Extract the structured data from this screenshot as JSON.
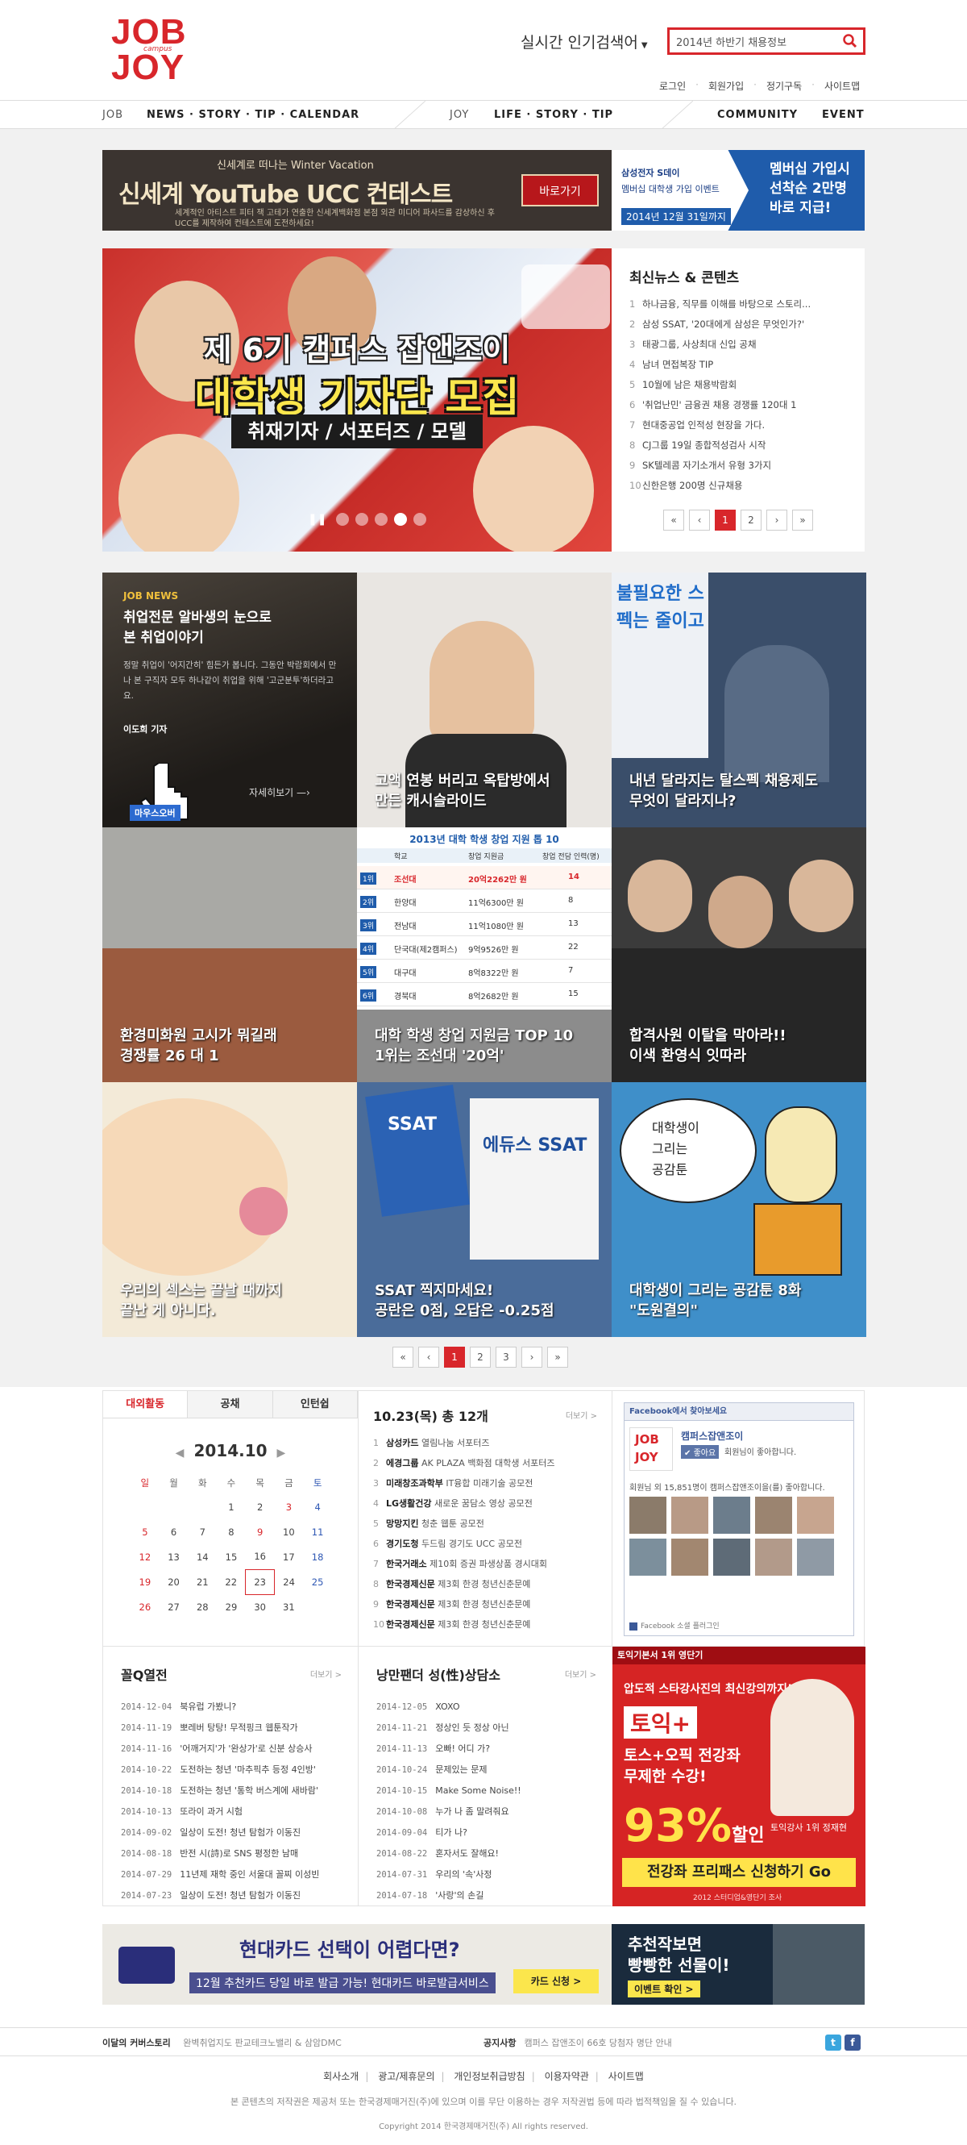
{
  "logo": {
    "line1": "JOB",
    "line2": "JOY",
    "small": "campus"
  },
  "header": {
    "popular_label": "실시간 인기검색어",
    "search_value": "2014년 하반기 채용정보",
    "utils": [
      "로그인",
      "회원가입",
      "정기구독",
      "사이트맵"
    ]
  },
  "gnb": {
    "job_label": "JOB",
    "job_menu": "NEWS · STORY · TIP · CALENDAR",
    "joy_label": "JOY",
    "joy_menu": "LIFE · STORY · TIP",
    "community": "COMMUNITY",
    "event": "EVENT"
  },
  "banner_top": {
    "left": {
      "eyebrow": "신세계로 떠나는 Winter Vacation",
      "title": "신세계 YouTube UCC 컨테스트",
      "desc": "세계적인 아티스트 피터 잭 고테가 연출한 신세계백화점 본점 외관 미디어 파사드를 감상하신 후 UCC를 제작하여 컨테스트에 도전하세요!",
      "button": "바로가기"
    },
    "right": {
      "brand": "삼성전자 S데이",
      "sub": "멤버십 대학생 가입 이벤트",
      "date": "2014년 12월 31일까지",
      "headline": "멤버십 가입시\n선착순 2만명\n바로 지급!"
    }
  },
  "hero": {
    "line1": "제 6기 캠퍼스 잡앤조이",
    "line2": "대학생 기자단 모집",
    "line3": "취재기자 / 서포터즈 / 모델",
    "dots": 5,
    "active_dot": 4
  },
  "latest": {
    "title": "최신뉴스 & 콘텐츠",
    "items": [
      {
        "n": "1",
        "t": "하나금융, 직무를 이해를 바탕으로 스토리..."
      },
      {
        "n": "2",
        "t": "삼성 SSAT, '20대에게 삼성은 무엇인가?'"
      },
      {
        "n": "3",
        "t": "태광그룹, 사상최대 신입 공채"
      },
      {
        "n": "4",
        "t": "남녀 면접복장 TIP"
      },
      {
        "n": "5",
        "t": "10월에 남은 채용박람회"
      },
      {
        "n": "6",
        "t": "'취업난민' 금융권 채용 경쟁률 120대 1"
      },
      {
        "n": "7",
        "t": "현대중공업 인적성 현장을 가다."
      },
      {
        "n": "8",
        "t": "CJ그룹 19일 종합적성검사 시작"
      },
      {
        "n": "9",
        "t": "SK텔레콤 자기소개서 유형 3가지"
      },
      {
        "n": "10",
        "t": "신한은행 200명 신규채용"
      }
    ],
    "pager": [
      "«",
      "‹",
      "1",
      "2",
      "›",
      "»"
    ],
    "current_page": "1"
  },
  "tiles": {
    "t1": {
      "tag": "JOB NEWS",
      "title": "취업전문 알바생의 눈으로\n본 취업이야기",
      "body": "정말 취업이 '어지간히' 힘든가 봅니다. 그동안 박람회에서 만나 본 구직자 모두 하나같이 취업을 위해 '고군분투'하더라고요.",
      "author": "이도희 기자",
      "more": "자세히보기",
      "hover_label": "마우스오버"
    },
    "t2": {
      "cap": "고액 연봉 버리고 옥탑방에서\n만든 캐시슬라이드"
    },
    "t3": {
      "cap": "내년 달라지는 탈스펙 채용제도\n무엇이 달라지나?",
      "sign": "불필요한 스펙는 줄이고"
    },
    "t4": {
      "cap": "환경미화원 고시가 뭐길래\n경쟁률 26 대 1"
    },
    "t5": {
      "cap": "대학 학생 창업 지원금 TOP 10\n1위는 조선대 '20억'",
      "table_title": "2013년 대학 학생 창업 지원 톱 10",
      "cols": [
        "학교",
        "창업 지원금",
        "창업 전담 인력(명)"
      ],
      "rows": [
        [
          "1위",
          "조선대",
          "20억2262만 원",
          "14"
        ],
        [
          "2위",
          "한양대",
          "11억6300만 원",
          "8"
        ],
        [
          "3위",
          "전남대",
          "11억1080만 원",
          "13"
        ],
        [
          "4위",
          "단국대(제2캠퍼스)",
          "9억9526만 원",
          "22"
        ],
        [
          "5위",
          "대구대",
          "8억8322만 원",
          "7"
        ],
        [
          "6위",
          "경북대",
          "8억2682만 원",
          "15"
        ]
      ]
    },
    "t6": {
      "cap": "합격사원 이탈을 막아라!!\n이색 환영식 잇따라"
    },
    "t7": {
      "cap": "우리의 섹스는 끝날 때까지\n끝난 게 아니다."
    },
    "t8": {
      "cap": "SSAT 찍지마세요!\n공란은 0점, 오답은 -0.25점",
      "book1": "SSAT",
      "book2": "에듀스 SSAT"
    },
    "t9": {
      "cap": "대학생이 그리는 공감툰 8화\n\"도원결의\"",
      "bubble": "대학생이\n그리는\n공감툰"
    }
  },
  "grid_pager": [
    "«",
    "‹",
    "1",
    "2",
    "3",
    "›",
    "»"
  ],
  "calendar": {
    "tabs": [
      "대외활동",
      "공채",
      "인턴쉽"
    ],
    "month": "2014.10",
    "weekdays": [
      "일",
      "월",
      "화",
      "수",
      "목",
      "금",
      "토"
    ],
    "weeks": [
      [
        "",
        "",
        "",
        "1",
        "2",
        "3",
        "4"
      ],
      [
        "5",
        "6",
        "7",
        "8",
        "9",
        "10",
        "11"
      ],
      [
        "12",
        "13",
        "14",
        "15",
        "16",
        "17",
        "18"
      ],
      [
        "19",
        "20",
        "21",
        "22",
        "23",
        "24",
        "25"
      ],
      [
        "26",
        "27",
        "28",
        "29",
        "30",
        "31",
        ""
      ]
    ],
    "today": "23"
  },
  "events": {
    "title": "10.23(목) 총 12개",
    "more": "더보기 >",
    "items": [
      {
        "n": "1",
        "org": "삼성카드",
        "t": "열림나눔 서포터즈"
      },
      {
        "n": "2",
        "org": "에경그룹",
        "t": "AK PLAZA 백화점 대학생 서포터즈"
      },
      {
        "n": "3",
        "org": "미래창조과학부",
        "t": "IT융합 미래기술 공모전"
      },
      {
        "n": "4",
        "org": "LG생활건강",
        "t": "새로운 꿈담소 영상 공모전"
      },
      {
        "n": "5",
        "org": "망망지킨",
        "t": "청춘 웹툰 공모전"
      },
      {
        "n": "6",
        "org": "경기도청",
        "t": "두드림 경기도 UCC 공모전"
      },
      {
        "n": "7",
        "org": "한국거래소",
        "t": "제10회 증권 파생상품 경시대회"
      },
      {
        "n": "8",
        "org": "한국경제신문",
        "t": "제3회 한경 청년신춘문예"
      },
      {
        "n": "9",
        "org": "한국경제신문",
        "t": "제3회 한경 청년신춘문예"
      },
      {
        "n": "10",
        "org": "한국경제신문",
        "t": "제3회 한경 청년신춘문예"
      }
    ]
  },
  "facebook": {
    "header": "Facebook에서 찾아보세요",
    "page_name": "캠퍼스잡앤조이",
    "like": "좋아요",
    "liked": "회원님이 좋아합니다.",
    "count_text": "회원님 외 15,851명이 캠퍼스잡앤조이을(를) 좋아합니다.",
    "footer": "Facebook 소셜 플러그인"
  },
  "qa": {
    "title": "꼴Q열전",
    "more": "더보기 >",
    "items": [
      {
        "d": "2014-12-04",
        "t": "북유럽 가봤니?"
      },
      {
        "d": "2014-11-19",
        "t": "뽀레버 탕탕! 무적핑크 웹툰작가"
      },
      {
        "d": "2014-11-16",
        "t": "'어깨거지'가 '완상가'로 신분 상승사"
      },
      {
        "d": "2014-10-22",
        "t": "도전하는 청년 '마추픽추 등정 4인방'"
      },
      {
        "d": "2014-10-18",
        "t": "도전하는 청년 '통학 버스계에 새바람'"
      },
      {
        "d": "2014-10-13",
        "t": "또라이 과거 시험"
      },
      {
        "d": "2014-09-02",
        "t": "일상이 도전! 청년 탐험가 이동진"
      },
      {
        "d": "2014-08-18",
        "t": "반전 시(詩)로 SNS 평정한 남매"
      },
      {
        "d": "2014-07-29",
        "t": "11년제 재학 중인 서울대 꼴찌 이성빈"
      },
      {
        "d": "2014-07-23",
        "t": "일상이 도전! 청년 탐험가 이동진"
      }
    ]
  },
  "romance": {
    "title": "낭만팬더 성(性)상담소",
    "more": "더보기 >",
    "items": [
      {
        "d": "2014-12-05",
        "t": "XOXO"
      },
      {
        "d": "2014-11-21",
        "t": "정상인 듯 정상 아닌"
      },
      {
        "d": "2014-11-13",
        "t": "오빠! 어디 가?"
      },
      {
        "d": "2014-10-24",
        "t": "문제있는 문제"
      },
      {
        "d": "2014-10-15",
        "t": "Make Some Noise!!"
      },
      {
        "d": "2014-10-08",
        "t": "누가 나 좀 말려줘요"
      },
      {
        "d": "2014-09-04",
        "t": "티가 나?"
      },
      {
        "d": "2014-08-22",
        "t": "혼자서도 잘해요!"
      },
      {
        "d": "2014-07-31",
        "t": "우리의 '속'사정"
      },
      {
        "d": "2014-07-18",
        "t": "'사랑'의 손길"
      }
    ]
  },
  "toeic_ad": {
    "top": "토익기본서 1위 영단기",
    "tag": "압도적 스타강사진의 최신강의까지!",
    "logo": "토익+",
    "line": "토스+오픽 전강좌\n무제한 수강!",
    "pct": "93%",
    "pct_suffix": "할인",
    "teacher": "토익강사 1위 정재현",
    "cta": "전강좌 프리패스 신청하기 Go",
    "footer": "2012 스터디업&영단기 조사"
  },
  "banner_bottom": {
    "left": {
      "headline": "현대카드 선택이 어렵다면?",
      "sub": "12월 추천카드 당일 바로 발급 가능! 현대카드 바로발급서비스",
      "button": "카드 신청 >"
    },
    "right": {
      "headline": "추천작보면\n빵빵한 선물이!",
      "button": "이벤트 확인 >"
    }
  },
  "footer": {
    "cover_label": "이달의 커버스토리",
    "cover_text": "완벽취업지도 판교테크노밸리 & 삼암DMC",
    "notice_label": "공지사항",
    "notice_text": "캠퍼스 잡앤조이 66호 당첨자 명단 안내",
    "links": [
      "회사소개",
      "광고/제휴문의",
      "개인정보취급방침",
      "이용자약관",
      "사이트맵"
    ],
    "copyright_note": "본 콘텐츠의 저작권은 제공처 또는 한국경제매거진(주)에 있으며 이를 무단 이용하는 경우 저작권법 등에 따라 법적책임을 질 수 있습니다.",
    "copyright": "Copyright 2014 한국경제매거진(주) All rights reserved."
  },
  "colors": {
    "brand": "#d8262b",
    "sat": "#2f58b4"
  }
}
